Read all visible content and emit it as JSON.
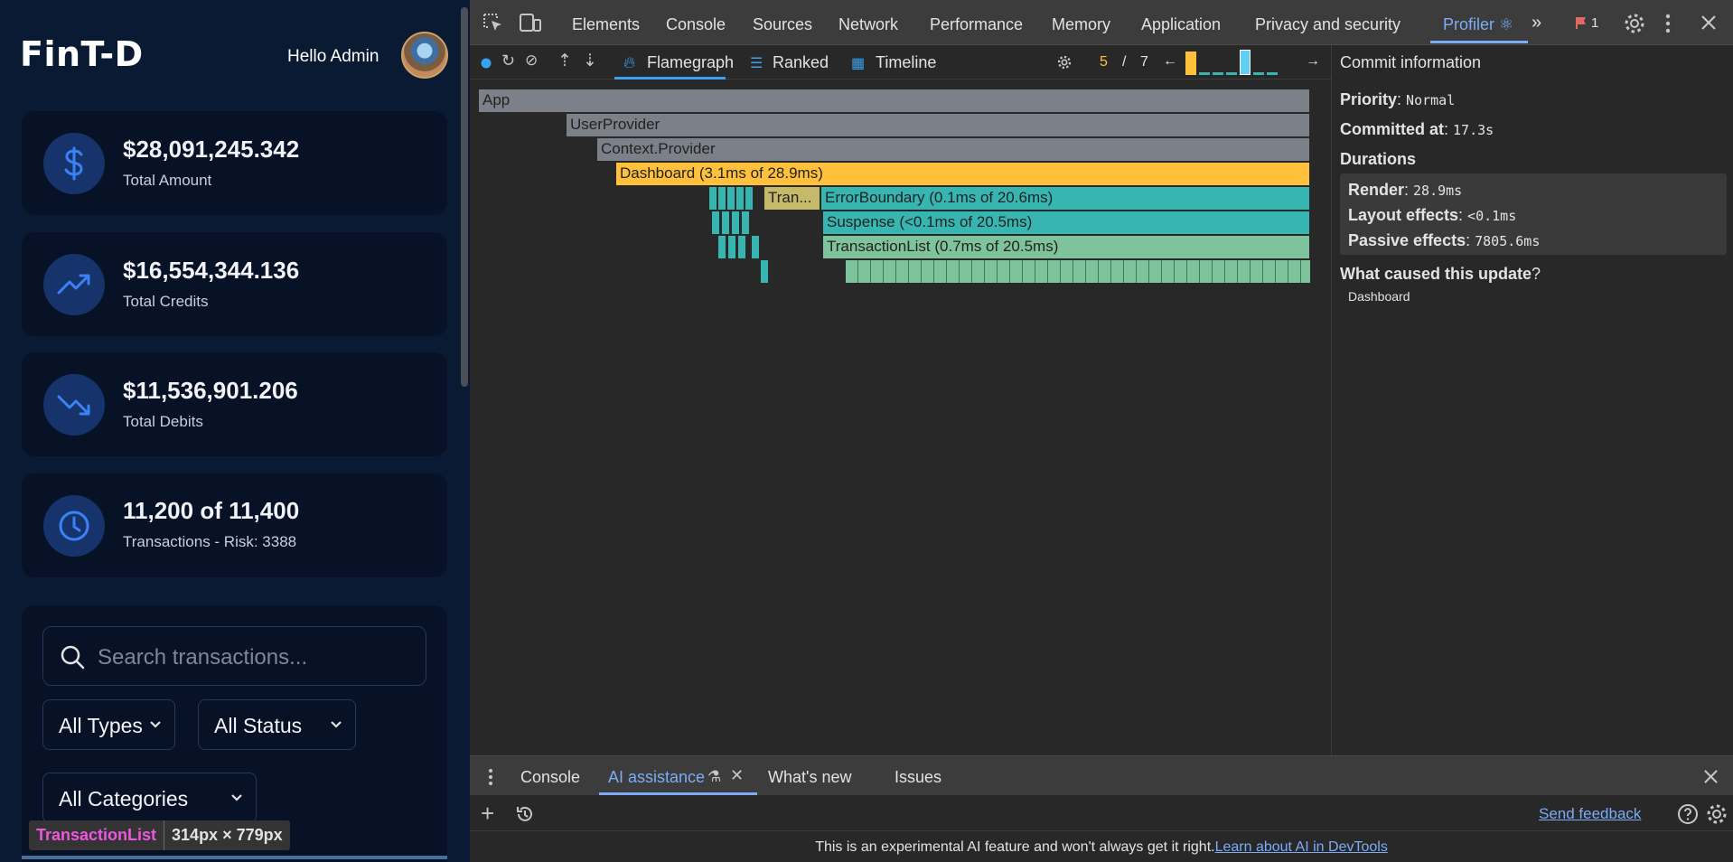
{
  "app": {
    "brand": "FinT-D",
    "greeting": "Hello Admin",
    "stats": [
      {
        "value": "$28,091,245.342",
        "label": "Total Amount",
        "icon": "dollar-icon"
      },
      {
        "value": "$16,554,344.136",
        "label": "Total Credits",
        "icon": "trending-up-icon"
      },
      {
        "value": "$11,536,901.206",
        "label": "Total Debits",
        "icon": "trending-down-icon"
      },
      {
        "value": "11,200 of 11,400",
        "label": "Transactions - Risk: 3388",
        "icon": "clock-icon"
      }
    ],
    "search": {
      "placeholder": "Search transactions..."
    },
    "filters": {
      "type": "All Types",
      "status": "All Status",
      "category": "All Categories"
    },
    "tooltip": {
      "name": "TransactionList",
      "dims": "314px × 779px"
    },
    "colors": {
      "accent": "#3b82f6",
      "card_bg": "#071226",
      "page_bg": "#0b1a33"
    }
  },
  "devtools": {
    "tabs": [
      "Elements",
      "Console",
      "Sources",
      "Network",
      "Performance",
      "Memory",
      "Application",
      "Privacy and security",
      "Profiler ⚛"
    ],
    "active_tab": "Profiler ⚛",
    "issue_count": "1",
    "profiler": {
      "views": [
        "Flamegraph",
        "Ranked",
        "Timeline"
      ],
      "active_view": "Flamegraph",
      "commit_current": "5",
      "commit_sep": "/",
      "commit_total": "7",
      "flame": {
        "app": "App",
        "user_provider": "UserProvider",
        "context_provider": "Context.Provider",
        "dashboard": "Dashboard (3.1ms of 28.9ms)",
        "tran": "Tran...",
        "error_boundary": "ErrorBoundary (0.1ms of 20.6ms)",
        "suspense": "Suspense (<0.1ms of 20.5ms)",
        "transaction_list": "TransactionList (0.7ms of 20.5ms)"
      },
      "commit_info": {
        "title": "Commit information",
        "priority_label": "Priority",
        "priority": "Normal",
        "committed_label": "Committed at",
        "committed": "17.3s",
        "durations_label": "Durations",
        "render_label": "Render",
        "render": "28.9ms",
        "layout_label": "Layout effects",
        "layout": "<0.1ms",
        "passive_label": "Passive effects",
        "passive": "7805.6ms",
        "cause_label": "What caused this update",
        "cause": "Dashboard"
      },
      "colors": {
        "yellow": "#ffc13b",
        "teal": "#37b5b1",
        "green": "#7ec39b",
        "gray": "#7c8088",
        "olive": "#c7b96a"
      }
    },
    "drawer": {
      "tabs": [
        "Console",
        "AI assistance",
        "What's new",
        "Issues"
      ],
      "active": "AI assistance",
      "send_feedback": "Send feedback",
      "footer_text": "This is an experimental AI feature and won't always get it right.",
      "footer_link": "Learn about AI in DevTools"
    }
  }
}
